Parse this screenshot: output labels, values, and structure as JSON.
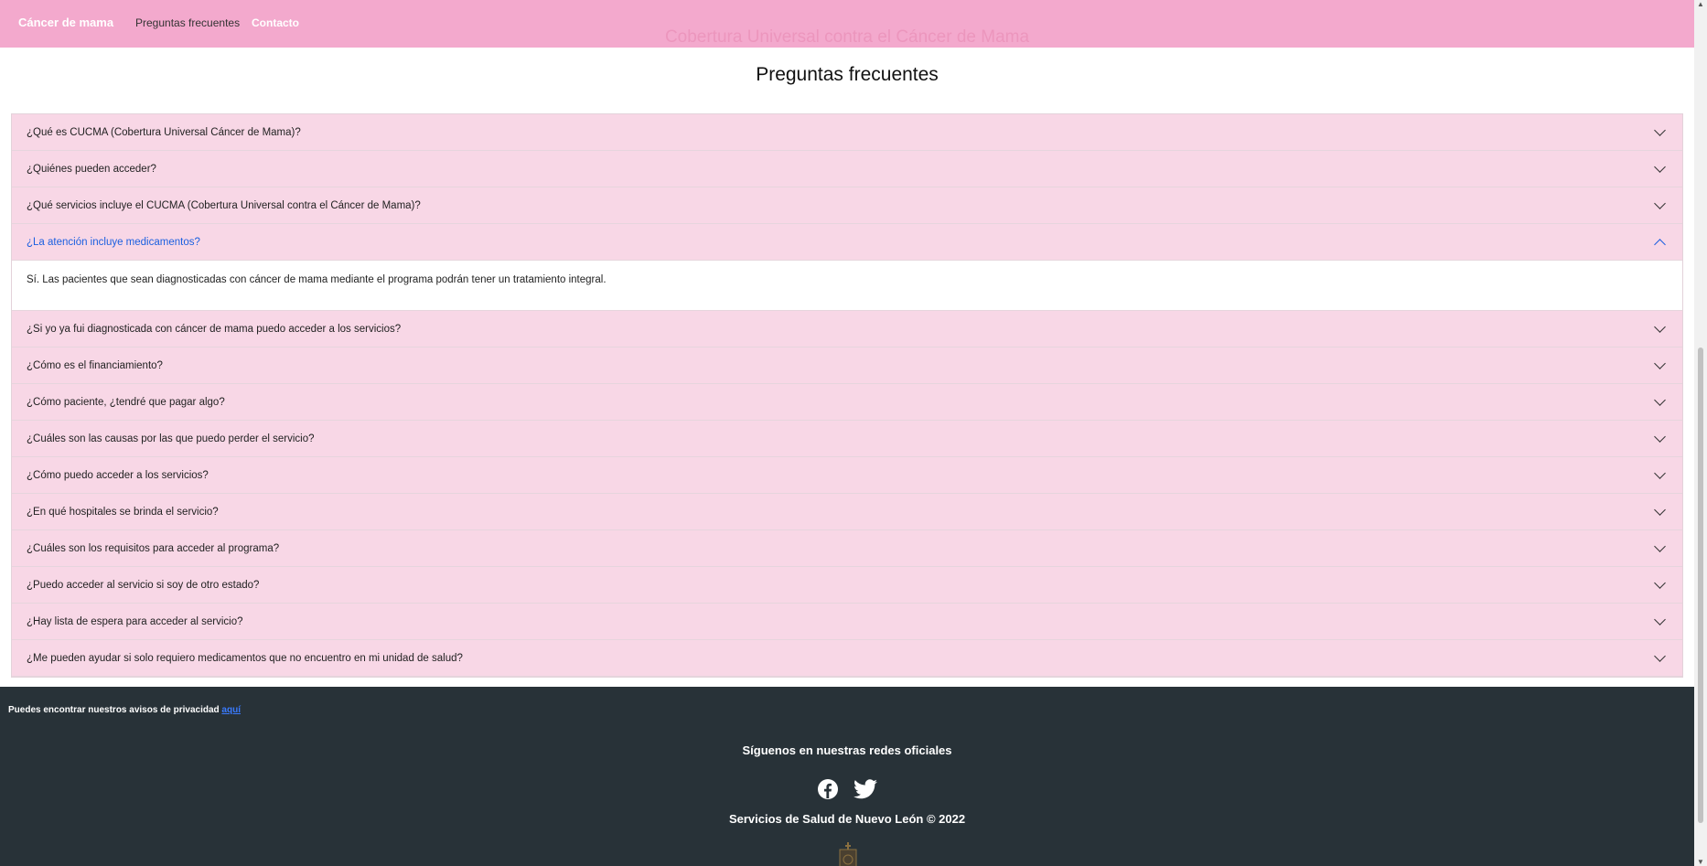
{
  "navbar": {
    "brand": "Cáncer de mama",
    "links": [
      "Preguntas frecuentes",
      "Contacto"
    ],
    "site_title": "Cobertura Universal contra el Cáncer de Mama"
  },
  "page_title": "Preguntas frecuentes",
  "faq": [
    {
      "q": "¿Qué es CUCMA (Cobertura Universal Cáncer de Mama)?"
    },
    {
      "q": "¿Quiénes pueden acceder?"
    },
    {
      "q": "¿Qué servicios incluye el CUCMA (Cobertura Universal contra el Cáncer de Mama)?"
    },
    {
      "q": "¿La atención incluye medicamentos?",
      "expanded": true,
      "a": "Sí. Las pacientes que sean diagnosticadas con cáncer de mama mediante el programa podrán tener un tratamiento integral."
    },
    {
      "q": "¿Si yo ya fui diagnosticada con cáncer de mama puedo acceder a los servicios?"
    },
    {
      "q": "¿Cómo es el financiamiento?"
    },
    {
      "q": "¿Cómo paciente, ¿tendré que pagar algo?"
    },
    {
      "q": "¿Cuáles son las causas por las que puedo perder el servicio?"
    },
    {
      "q": "¿Cómo puedo acceder a los servicios?"
    },
    {
      "q": "¿En qué hospitales se brinda el servicio?"
    },
    {
      "q": "¿Cuáles son los requisitos para acceder al programa?"
    },
    {
      "q": "¿Puedo acceder al servicio si soy de otro estado?"
    },
    {
      "q": "¿Hay lista de espera para acceder al servicio?"
    },
    {
      "q": "¿Me pueden ayudar si solo requiero medicamentos que no encuentro en mi unidad de salud?"
    }
  ],
  "footer": {
    "privacy_text": "Puedes encontrar nuestros avisos de privacidad ",
    "privacy_link": "aquí",
    "follow": "Síguenos en nuestras redes oficiales",
    "social": [
      "facebook-icon",
      "twitter-icon"
    ],
    "copyright": "Servicios de Salud de Nuevo León © 2022"
  },
  "colors": {
    "navbar": "#f3a9cd",
    "accordion": "#f8d7e6",
    "footer": "#283238",
    "active": "#1a5fe0"
  }
}
